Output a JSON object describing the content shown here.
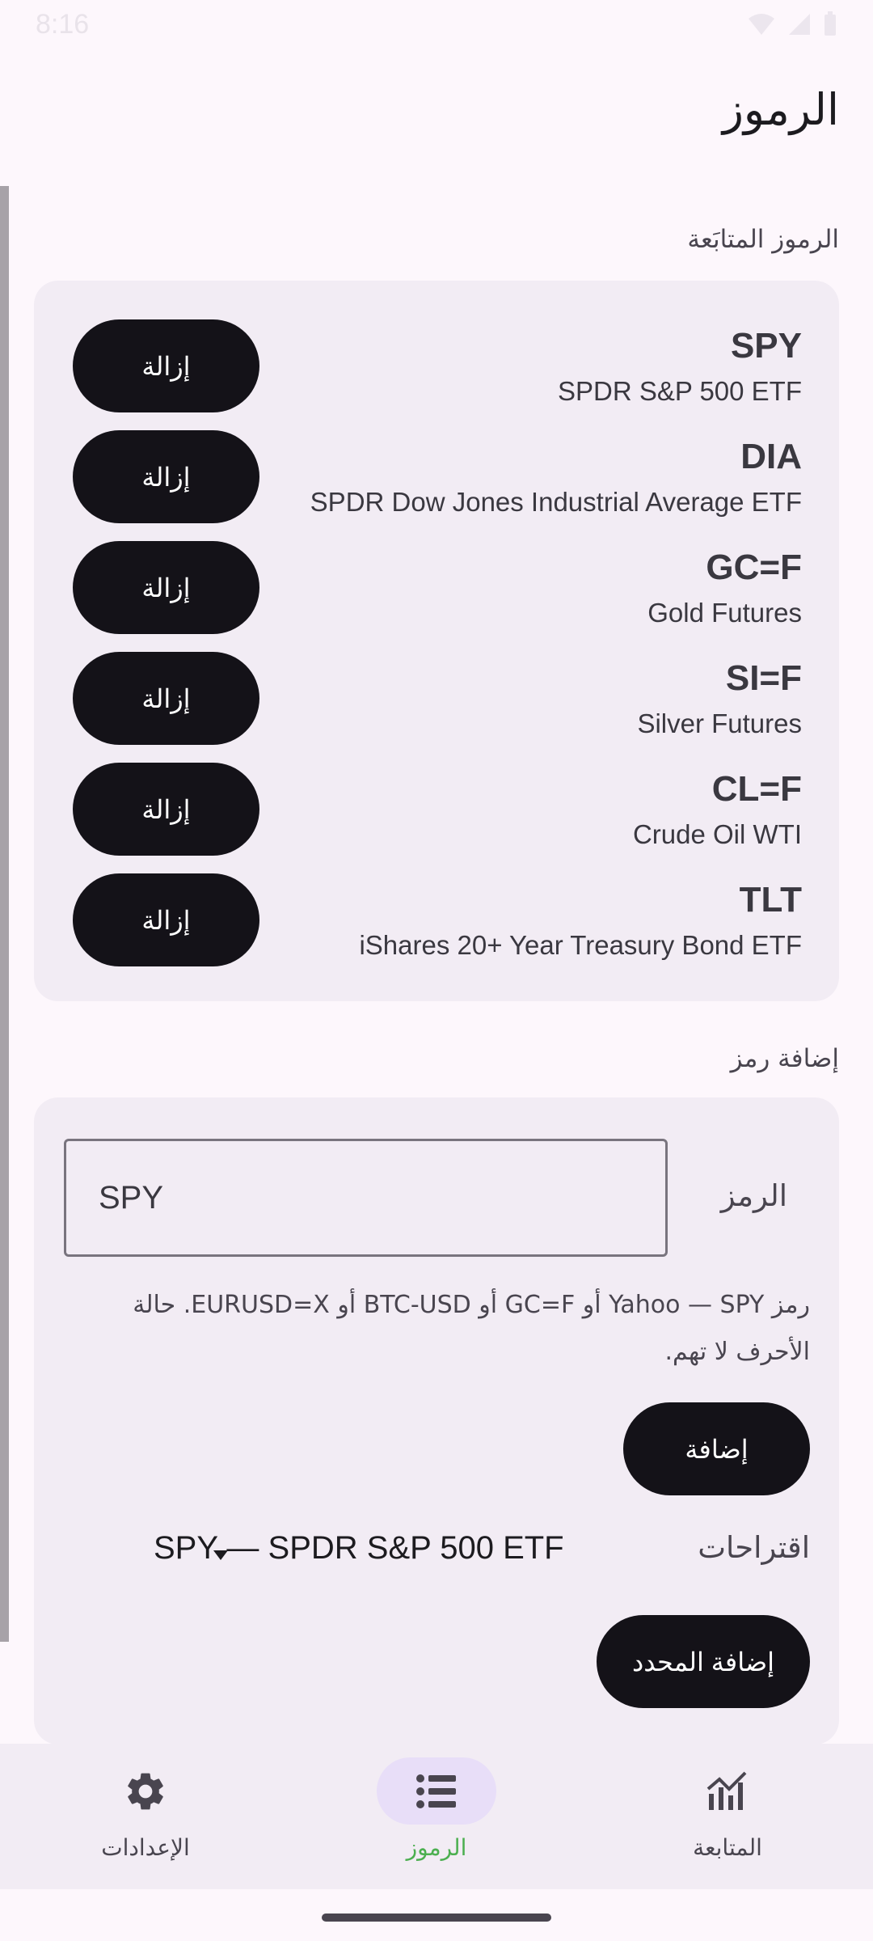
{
  "status_bar": {
    "time": "8:16"
  },
  "app_bar": {
    "title": "الرموز"
  },
  "tracked": {
    "section_label": "الرموز المتابَعة",
    "remove_label": "إزالة",
    "items": [
      {
        "code": "SPY",
        "name": "SPDR S&P 500 ETF"
      },
      {
        "code": "DIA",
        "name": "SPDR Dow Jones Industrial Average ETF"
      },
      {
        "code": "GC=F",
        "name": "Gold Futures"
      },
      {
        "code": "SI=F",
        "name": "Silver Futures"
      },
      {
        "code": "CL=F",
        "name": "Crude Oil WTI"
      },
      {
        "code": "TLT",
        "name": "iShares 20+ Year Treasury Bond ETF"
      }
    ]
  },
  "add_symbol": {
    "section_label": "إضافة رمز",
    "field_label": "الرمز",
    "field_value": "SPY",
    "helper_text": "رمز Yahoo — SPY أو GC=F أو BTC-USD أو EURUSD=X. حالة الأحرف لا تهم.",
    "add_button": "إضافة",
    "suggestions_label": "اقتراحات",
    "suggestion_value": "SPY — SPDR S&P 500 ETF",
    "add_selected_button": "إضافة المحدد"
  },
  "bottom_nav": {
    "items": [
      {
        "label": "الإعدادات",
        "icon": "gear-icon"
      },
      {
        "label": "الرموز",
        "icon": "list-icon",
        "active": true
      },
      {
        "label": "المتابعة",
        "icon": "chart-icon"
      }
    ],
    "active_color": "#4caf50",
    "active_pill_color": "#e8def8"
  }
}
